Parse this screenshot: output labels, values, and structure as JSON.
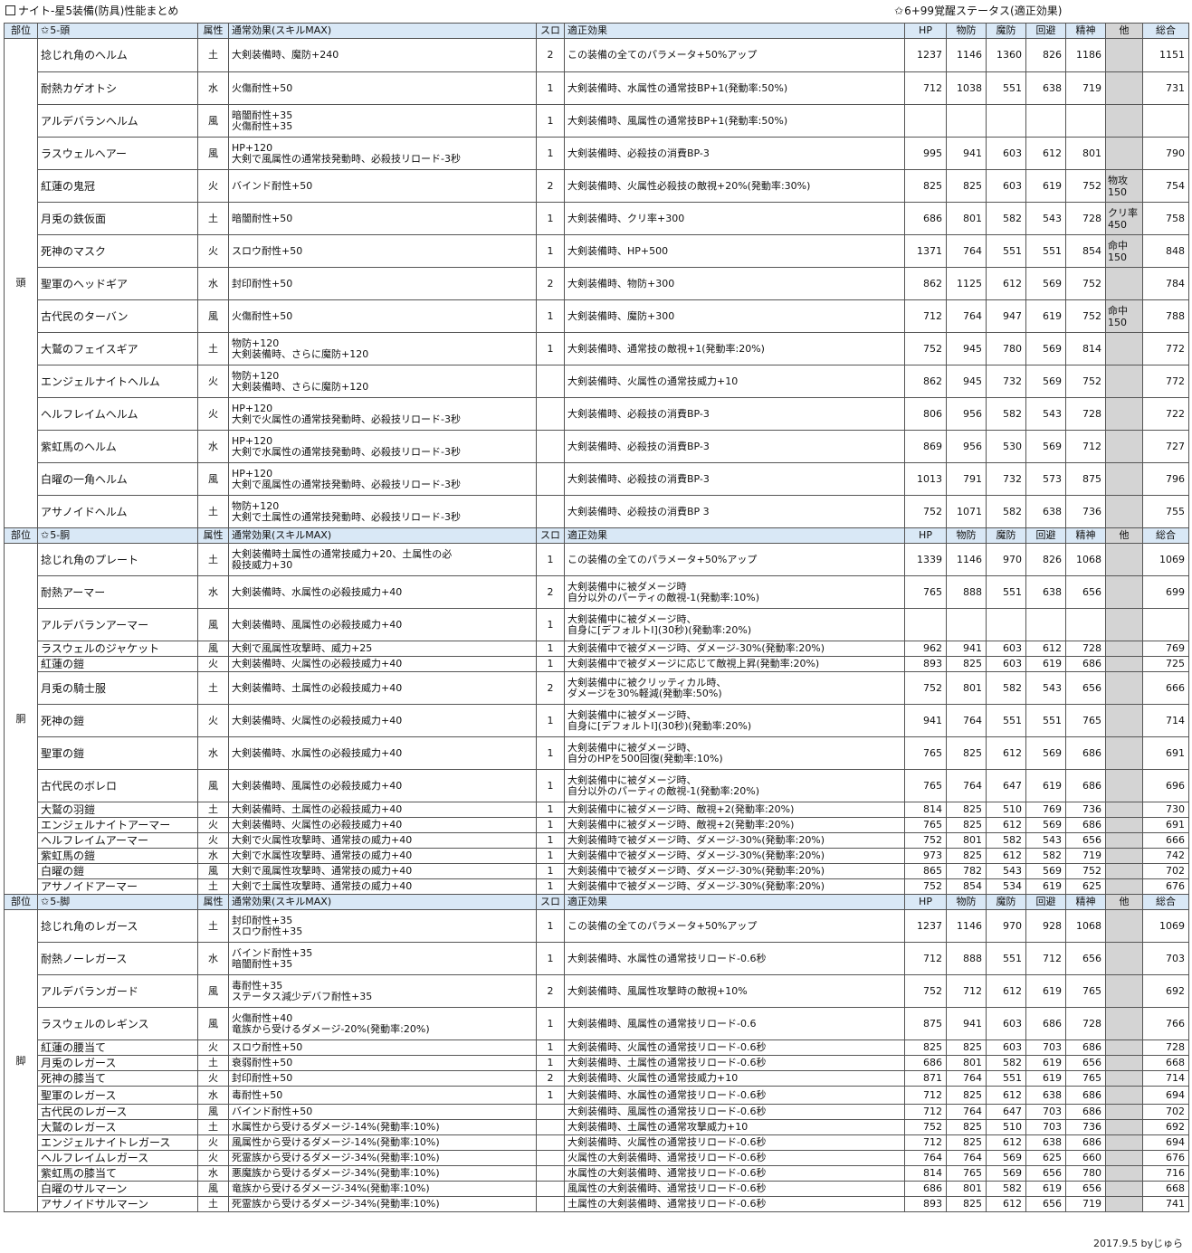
{
  "title": "ナイト-星5装備(防具)性能まとめ",
  "subtitle": "6+99覚醒ステータス(適正効果)",
  "footer": "2017.9.5 byじゅら",
  "headers": {
    "part": "部位",
    "attr": "属性",
    "effect": "通常効果(スキルMAX)",
    "slot": "スロ",
    "fit": "適正効果",
    "hp": "HP",
    "pdef": "物防",
    "mdef": "魔防",
    "eva": "回避",
    "mind": "精神",
    "other": "他",
    "total": "総合"
  },
  "sections": [
    {
      "part": "頭",
      "header": "5-頭",
      "rows": [
        {
          "name": "捻じれ角のヘルム",
          "attr": "土",
          "effect": [
            "大剣装備時、魔防+240"
          ],
          "slot": "2",
          "fit": [
            "この装備の全てのパラメータ+50%アップ"
          ],
          "hp": "1237",
          "pdef": "1146",
          "mdef": "1360",
          "eva": "826",
          "mind": "1186",
          "other": [],
          "total": "1151"
        },
        {
          "name": "耐熱カゲオトシ",
          "attr": "水",
          "effect": [
            "火傷耐性+50"
          ],
          "slot": "1",
          "fit": [
            "大剣装備時、水属性の通常技BP+1(発動率:50%)"
          ],
          "hp": "712",
          "pdef": "1038",
          "mdef": "551",
          "eva": "638",
          "mind": "719",
          "other": [],
          "total": "731"
        },
        {
          "name": "アルデバランヘルム",
          "attr": "風",
          "effect": [
            "暗闇耐性+35",
            "火傷耐性+35"
          ],
          "slot": "1",
          "fit": [
            "大剣装備時、風属性の通常技BP+1(発動率:50%)"
          ],
          "hp": "",
          "pdef": "",
          "mdef": "",
          "eva": "",
          "mind": "",
          "other": [],
          "total": ""
        },
        {
          "name": "ラスウェルヘアー",
          "attr": "風",
          "effect": [
            "HP+120",
            "大剣で風属性の通常技発動時、必殺技リロード-3秒"
          ],
          "slot": "1",
          "fit": [
            "大剣装備時、必殺技の消費BP-3"
          ],
          "hp": "995",
          "pdef": "941",
          "mdef": "603",
          "eva": "612",
          "mind": "801",
          "other": [],
          "total": "790"
        },
        {
          "name": "紅蓮の鬼冠",
          "attr": "火",
          "effect": [
            "バインド耐性+50"
          ],
          "slot": "2",
          "fit": [
            "大剣装備時、火属性必殺技の敵視+20%(発動率:30%)"
          ],
          "hp": "825",
          "pdef": "825",
          "mdef": "603",
          "eva": "619",
          "mind": "752",
          "other": [
            "物攻",
            "150"
          ],
          "total": "754"
        },
        {
          "name": "月兎の鉄仮面",
          "attr": "土",
          "effect": [
            "暗闇耐性+50"
          ],
          "slot": "1",
          "fit": [
            "大剣装備時、クリ率+300"
          ],
          "hp": "686",
          "pdef": "801",
          "mdef": "582",
          "eva": "543",
          "mind": "728",
          "other": [
            "クリ率",
            "450"
          ],
          "total": "758"
        },
        {
          "name": "死神のマスク",
          "attr": "火",
          "effect": [
            "スロウ耐性+50"
          ],
          "slot": "1",
          "fit": [
            "大剣装備時、HP+500"
          ],
          "hp": "1371",
          "pdef": "764",
          "mdef": "551",
          "eva": "551",
          "mind": "854",
          "other": [
            "命中",
            "150"
          ],
          "total": "848"
        },
        {
          "name": "聖軍のヘッドギア",
          "attr": "水",
          "effect": [
            "封印耐性+50"
          ],
          "slot": "2",
          "fit": [
            "大剣装備時、物防+300"
          ],
          "hp": "862",
          "pdef": "1125",
          "mdef": "612",
          "eva": "569",
          "mind": "752",
          "other": [],
          "total": "784"
        },
        {
          "name": "古代民のターバン",
          "attr": "風",
          "effect": [
            "火傷耐性+50"
          ],
          "slot": "1",
          "fit": [
            "大剣装備時、魔防+300"
          ],
          "hp": "712",
          "pdef": "764",
          "mdef": "947",
          "eva": "619",
          "mind": "752",
          "other": [
            "命中",
            "150"
          ],
          "total": "788"
        },
        {
          "name": "大鷲のフェイスギア",
          "attr": "土",
          "effect": [
            "物防+120",
            "大剣装備時、さらに魔防+120"
          ],
          "slot": "1",
          "fit": [
            "大剣装備時、通常技の敵視+1(発動率:20%)"
          ],
          "hp": "752",
          "pdef": "945",
          "mdef": "780",
          "eva": "569",
          "mind": "814",
          "other": [],
          "total": "772"
        },
        {
          "name": "エンジェルナイトヘルム",
          "attr": "火",
          "effect": [
            "物防+120",
            "大剣装備時、さらに魔防+120"
          ],
          "slot": "",
          "fit": [
            "大剣装備時、火属性の通常技威力+10"
          ],
          "hp": "862",
          "pdef": "945",
          "mdef": "732",
          "eva": "569",
          "mind": "752",
          "other": [],
          "total": "772"
        },
        {
          "name": "ヘルフレイムヘルム",
          "attr": "火",
          "effect": [
            "HP+120",
            "大剣で火属性の通常技発動時、必殺技リロード-3秒"
          ],
          "slot": "",
          "fit": [
            "大剣装備時、必殺技の消費BP-3"
          ],
          "hp": "806",
          "pdef": "956",
          "mdef": "582",
          "eva": "543",
          "mind": "728",
          "other": [],
          "total": "722"
        },
        {
          "name": "紫虹馬のヘルム",
          "attr": "水",
          "effect": [
            "HP+120",
            "大剣で水属性の通常技発動時、必殺技リロード-3秒"
          ],
          "slot": "",
          "fit": [
            "大剣装備時、必殺技の消費BP-3"
          ],
          "hp": "869",
          "pdef": "956",
          "mdef": "530",
          "eva": "569",
          "mind": "712",
          "other": [],
          "total": "727"
        },
        {
          "name": "白曜の一角ヘルム",
          "attr": "風",
          "effect": [
            "HP+120",
            "大剣で風属性の通常技発動時、必殺技リロード-3秒"
          ],
          "slot": "",
          "fit": [
            "大剣装備時、必殺技の消費BP-3"
          ],
          "hp": "1013",
          "pdef": "791",
          "mdef": "732",
          "eva": "573",
          "mind": "875",
          "other": [],
          "total": "796"
        },
        {
          "name": "アサノイドヘルム",
          "attr": "土",
          "effect": [
            "物防+120",
            "大剣で土属性の通常技発動時、必殺技リロード-3秒"
          ],
          "slot": "",
          "fit": [
            "大剣装備時、必殺技の消費BP 3"
          ],
          "hp": "752",
          "pdef": "1071",
          "mdef": "582",
          "eva": "638",
          "mind": "736",
          "other": [],
          "total": "755"
        }
      ]
    },
    {
      "part": "胴",
      "header": "5-胴",
      "rows": [
        {
          "name": "捻じれ角のプレート",
          "attr": "土",
          "effect": [
            "大剣装備時土属性の通常技威力+20、土属性の必",
            "殺技威力+30"
          ],
          "slot": "1",
          "fit": [
            "この装備の全てのパラメータ+50%アップ"
          ],
          "hp": "1339",
          "pdef": "1146",
          "mdef": "970",
          "eva": "826",
          "mind": "1068",
          "other": [],
          "total": "1069"
        },
        {
          "name": "耐熱アーマー",
          "attr": "水",
          "effect": [
            "大剣装備時、水属性の必殺技威力+40"
          ],
          "slot": "2",
          "fit": [
            "大剣装備中に被ダメージ時",
            "自分以外のパーティの敵視-1(発動率:10%)"
          ],
          "hp": "765",
          "pdef": "888",
          "mdef": "551",
          "eva": "638",
          "mind": "656",
          "other": [],
          "total": "699"
        },
        {
          "name": "アルデバランアーマー",
          "attr": "風",
          "effect": [
            "大剣装備時、風属性の必殺技威力+40"
          ],
          "slot": "1",
          "fit": [
            "大剣装備中に被ダメージ時、",
            "自身に[デフォルトI](30秒)(発動率:20%)"
          ],
          "hp": "",
          "pdef": "",
          "mdef": "",
          "eva": "",
          "mind": "",
          "other": [],
          "total": ""
        },
        {
          "name": "ラスウェルのジャケット",
          "attr": "風",
          "effect": [
            "大剣で風属性攻撃時、威力+25"
          ],
          "slot": "1",
          "fit": [
            "大剣装備中で被ダメージ時、ダメージ-30%(発動率:20%)"
          ],
          "hp": "962",
          "pdef": "941",
          "mdef": "603",
          "eva": "612",
          "mind": "728",
          "other": [],
          "total": "769"
        },
        {
          "name": "紅蓮の鎧",
          "attr": "火",
          "effect": [
            "大剣装備時、火属性の必殺技威力+40"
          ],
          "slot": "1",
          "fit": [
            "大剣装備中で被ダメージに応じて敵視上昇(発動率:20%)"
          ],
          "hp": "893",
          "pdef": "825",
          "mdef": "603",
          "eva": "619",
          "mind": "686",
          "other": [],
          "total": "725"
        },
        {
          "name": "月兎の騎士服",
          "attr": "土",
          "effect": [
            "大剣装備時、土属性の必殺技威力+40"
          ],
          "slot": "2",
          "fit": [
            "大剣装備中に被クリッティカル時、",
            "ダメージを30%軽減(発動率:50%)"
          ],
          "hp": "752",
          "pdef": "801",
          "mdef": "582",
          "eva": "543",
          "mind": "656",
          "other": [],
          "total": "666"
        },
        {
          "name": "死神の鎧",
          "attr": "火",
          "effect": [
            "大剣装備時、火属性の必殺技威力+40"
          ],
          "slot": "1",
          "fit": [
            "大剣装備中に被ダメージ時、",
            "自身に[デフォルトI](30秒)(発動率:20%)"
          ],
          "hp": "941",
          "pdef": "764",
          "mdef": "551",
          "eva": "551",
          "mind": "765",
          "other": [],
          "total": "714"
        },
        {
          "name": "聖軍の鎧",
          "attr": "水",
          "effect": [
            "大剣装備時、水属性の必殺技威力+40"
          ],
          "slot": "1",
          "fit": [
            "大剣装備中に被ダメージ時、",
            "自分のHPを500回復(発動率:10%)"
          ],
          "hp": "765",
          "pdef": "825",
          "mdef": "612",
          "eva": "569",
          "mind": "686",
          "other": [],
          "total": "691"
        },
        {
          "name": "古代民のボレロ",
          "attr": "風",
          "effect": [
            "大剣装備時、風属性の必殺技威力+40"
          ],
          "slot": "1",
          "fit": [
            "大剣装備中に被ダメージ時、",
            "自分以外のパーティの敵視-1(発動率:20%)"
          ],
          "hp": "765",
          "pdef": "764",
          "mdef": "647",
          "eva": "619",
          "mind": "686",
          "other": [],
          "total": "696"
        },
        {
          "name": "大鷲の羽鎧",
          "attr": "土",
          "effect": [
            "大剣装備時、土属性の必殺技威力+40"
          ],
          "slot": "1",
          "fit": [
            "大剣装備中に被ダメージ時、敵視+2(発動率:20%)"
          ],
          "hp": "814",
          "pdef": "825",
          "mdef": "510",
          "eva": "769",
          "mind": "736",
          "other": [],
          "total": "730"
        },
        {
          "name": "エンジェルナイトアーマー",
          "attr": "火",
          "effect": [
            "大剣装備時、火属性の必殺技威力+40"
          ],
          "slot": "1",
          "fit": [
            "大剣装備中に被ダメージ時、敵視+2(発動率:20%)"
          ],
          "hp": "765",
          "pdef": "825",
          "mdef": "612",
          "eva": "569",
          "mind": "686",
          "other": [],
          "total": "691"
        },
        {
          "name": "ヘルフレイムアーマー",
          "attr": "火",
          "effect": [
            "大剣で火属性攻撃時、通常技の威力+40"
          ],
          "slot": "1",
          "fit": [
            "大剣装備時で被ダメージ時、ダメージ-30%(発動率:20%)"
          ],
          "hp": "752",
          "pdef": "801",
          "mdef": "582",
          "eva": "543",
          "mind": "656",
          "other": [],
          "total": "666"
        },
        {
          "name": "紫虹馬の鎧",
          "attr": "水",
          "effect": [
            "大剣で水属性攻撃時、通常技の威力+40"
          ],
          "slot": "1",
          "fit": [
            "大剣装備中で被ダメージ時、ダメージ-30%(発動率:20%)"
          ],
          "hp": "973",
          "pdef": "825",
          "mdef": "612",
          "eva": "582",
          "mind": "719",
          "other": [],
          "total": "742"
        },
        {
          "name": "白曜の鎧",
          "attr": "風",
          "effect": [
            "大剣で風属性攻撃時、通常技の威力+40"
          ],
          "slot": "1",
          "fit": [
            "大剣装備中で被ダメージ時、ダメージ-30%(発動率:20%)"
          ],
          "hp": "865",
          "pdef": "782",
          "mdef": "543",
          "eva": "569",
          "mind": "752",
          "other": [],
          "total": "702"
        },
        {
          "name": "アサノイドアーマー",
          "attr": "土",
          "effect": [
            "大剣で土属性攻撃時、通常技の威力+40"
          ],
          "slot": "1",
          "fit": [
            "大剣装備中で被ダメージ時、ダメージ-30%(発動率:20%)"
          ],
          "hp": "752",
          "pdef": "854",
          "mdef": "534",
          "eva": "619",
          "mind": "625",
          "other": [],
          "total": "676"
        }
      ]
    },
    {
      "part": "脚",
      "header": "5-脚",
      "rows": [
        {
          "name": "捻じれ角のレガース",
          "attr": "土",
          "effect": [
            "封印耐性+35",
            "スロウ耐性+35"
          ],
          "slot": "1",
          "fit": [
            "この装備の全てのパラメータ+50%アップ"
          ],
          "hp": "1237",
          "pdef": "1146",
          "mdef": "970",
          "eva": "928",
          "mind": "1068",
          "other": [],
          "total": "1069"
        },
        {
          "name": "耐熱ノーレガース",
          "attr": "水",
          "effect": [
            "バインド耐性+35",
            "暗闇耐性+35"
          ],
          "slot": "1",
          "fit": [
            "大剣装備時、水属性の通常技リロード-0.6秒"
          ],
          "hp": "712",
          "pdef": "888",
          "mdef": "551",
          "eva": "712",
          "mind": "656",
          "other": [],
          "total": "703"
        },
        {
          "name": "アルデバランガード",
          "attr": "風",
          "effect": [
            "毒耐性+35",
            "ステータス減少デバフ耐性+35"
          ],
          "slot": "2",
          "fit": [
            "大剣装備時、風属性攻撃時の敵視+10%"
          ],
          "hp": "752",
          "pdef": "712",
          "mdef": "612",
          "eva": "619",
          "mind": "765",
          "other": [],
          "total": "692"
        },
        {
          "name": "ラスウェルのレギンス",
          "attr": "風",
          "effect": [
            "火傷耐性+40",
            "竜族から受けるダメージ-20%(発動率:20%)"
          ],
          "slot": "1",
          "fit": [
            "大剣装備時、風属性の通常技リロード-0.6"
          ],
          "hp": "875",
          "pdef": "941",
          "mdef": "603",
          "eva": "686",
          "mind": "728",
          "other": [],
          "total": "766"
        },
        {
          "name": "紅蓮の腰当て",
          "attr": "火",
          "effect": [
            "スロウ耐性+50"
          ],
          "slot": "1",
          "fit": [
            "大剣装備時、火属性の通常技リロード-0.6秒"
          ],
          "hp": "825",
          "pdef": "825",
          "mdef": "603",
          "eva": "703",
          "mind": "686",
          "other": [],
          "total": "728"
        },
        {
          "name": "月兎のレガース",
          "attr": "土",
          "effect": [
            "衰弱耐性+50"
          ],
          "slot": "1",
          "fit": [
            "大剣装備時、土属性の通常技リロード-0.6秒"
          ],
          "hp": "686",
          "pdef": "801",
          "mdef": "582",
          "eva": "619",
          "mind": "656",
          "other": [],
          "total": "668"
        },
        {
          "name": "死神の膝当て",
          "attr": "火",
          "effect": [
            "封印耐性+50"
          ],
          "slot": "2",
          "fit": [
            "大剣装備時、火属性の通常技威力+10"
          ],
          "hp": "871",
          "pdef": "764",
          "mdef": "551",
          "eva": "619",
          "mind": "765",
          "other": [],
          "total": "714"
        },
        {
          "name": "聖軍のレガース",
          "attr": "水",
          "effect": [
            "毒耐性+50"
          ],
          "slot": "1",
          "fit": [
            "大剣装備時、水属性の通常技リロード-0.6秒"
          ],
          "hp": "712",
          "pdef": "825",
          "mdef": "612",
          "eva": "638",
          "mind": "686",
          "other": [],
          "total": "694"
        },
        {
          "name": "古代民のレガース",
          "attr": "風",
          "effect": [
            "バインド耐性+50"
          ],
          "slot": "",
          "fit": [
            "大剣装備時、風属性の通常技リロード-0.6秒"
          ],
          "hp": "712",
          "pdef": "764",
          "mdef": "647",
          "eva": "703",
          "mind": "686",
          "other": [],
          "total": "702"
        },
        {
          "name": "大鷲のレガース",
          "attr": "土",
          "effect": [
            "水属性から受けるダメージ-14%(発動率:10%)"
          ],
          "slot": "",
          "fit": [
            "大剣装備時、土属性の通常攻撃威力+10"
          ],
          "hp": "752",
          "pdef": "825",
          "mdef": "510",
          "eva": "703",
          "mind": "736",
          "other": [],
          "total": "692"
        },
        {
          "name": "エンジェルナイトレガース",
          "attr": "火",
          "effect": [
            "風属性から受けるダメージ-14%(発動率:10%)"
          ],
          "slot": "",
          "fit": [
            "大剣装備時、火属性の通常技リロード-0.6秒"
          ],
          "hp": "712",
          "pdef": "825",
          "mdef": "612",
          "eva": "638",
          "mind": "686",
          "other": [],
          "total": "694"
        },
        {
          "name": "ヘルフレイムレガース",
          "attr": "火",
          "effect": [
            "死霊族から受けるダメージ-34%(発動率:10%)"
          ],
          "slot": "",
          "fit": [
            "火属性の大剣装備時、通常技リロード-0.6秒"
          ],
          "hp": "764",
          "pdef": "764",
          "mdef": "569",
          "eva": "625",
          "mind": "660",
          "other": [],
          "total": "676"
        },
        {
          "name": "紫虹馬の膝当て",
          "attr": "水",
          "effect": [
            "悪魔族から受けるダメージ-34%(発動率:10%)"
          ],
          "slot": "",
          "fit": [
            "水属性の大剣装備時、通常技リロード-0.6秒"
          ],
          "hp": "814",
          "pdef": "765",
          "mdef": "569",
          "eva": "656",
          "mind": "780",
          "other": [],
          "total": "716"
        },
        {
          "name": "白曜のサルマーン",
          "attr": "風",
          "effect": [
            "竜族から受けるダメージ-34%(発動率:10%)"
          ],
          "slot": "",
          "fit": [
            "風属性の大剣装備時、通常技リロード-0.6秒"
          ],
          "hp": "686",
          "pdef": "801",
          "mdef": "582",
          "eva": "619",
          "mind": "656",
          "other": [],
          "total": "668"
        },
        {
          "name": "アサノイドサルマーン",
          "attr": "土",
          "effect": [
            "死霊族から受けるダメージ-34%(発動率:10%)"
          ],
          "slot": "",
          "fit": [
            "土属性の大剣装備時、通常技リロード-0.6秒"
          ],
          "hp": "893",
          "pdef": "825",
          "mdef": "612",
          "eva": "656",
          "mind": "719",
          "other": [],
          "total": "741"
        }
      ]
    }
  ]
}
